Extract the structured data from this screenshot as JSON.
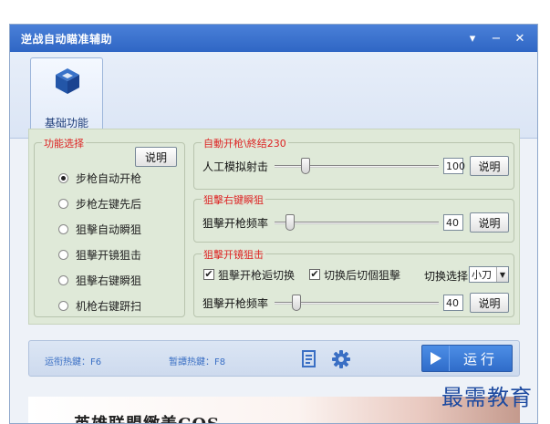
{
  "window": {
    "title": "逆战自动瞄准辅助",
    "controls": {
      "menu": "▾",
      "minimize": "−",
      "close": "✕"
    }
  },
  "toolbar": {
    "tab_label": "基础功能",
    "tab_icon": "cube-icon"
  },
  "function_select": {
    "legend": "功能选择",
    "help_label": "说明",
    "options": [
      {
        "label": "步枪自动开枪",
        "selected": true
      },
      {
        "label": "步枪左键先后",
        "selected": false
      },
      {
        "label": "狙擊自动瞬狙",
        "selected": false
      },
      {
        "label": "狙擊开镜狙击",
        "selected": false
      },
      {
        "label": "狙擊右键瞬狙",
        "selected": false
      },
      {
        "label": "机枪右键趼扫",
        "selected": false
      }
    ]
  },
  "auto_fire": {
    "legend": "自動开枪\\終结230",
    "label": "人工模拟射击",
    "value": "100",
    "help_label": "说明",
    "slider_percent": 17
  },
  "sniper_right": {
    "legend": "狙擊右键瞬狙",
    "label": "狙擊开枪频率",
    "value": "40",
    "help_label": "说明",
    "slider_percent": 7
  },
  "sniper_scope": {
    "legend": "狙擊开镜狙击",
    "check1": {
      "label": "狙擊开枪逅切换",
      "checked": true
    },
    "check2": {
      "label": "切换后切個狙擊",
      "checked": true
    },
    "switch_label": "切换选择",
    "switch_value": "小刀",
    "label": "狙擊开枪频率",
    "value": "40",
    "help_label": "说明",
    "slider_percent": 11
  },
  "status": {
    "run_hotkey": "运衔热鍵：F6",
    "pause_hotkey": "暂譚热鍵：F8",
    "run_label": "运行"
  },
  "banner": {
    "text": "英雄联盟緻美COS"
  },
  "watermark": "最需教育",
  "colors": {
    "title_bar": "#2f66c4",
    "legend_red": "#dd2222",
    "run_button": "#2f6cc9"
  }
}
